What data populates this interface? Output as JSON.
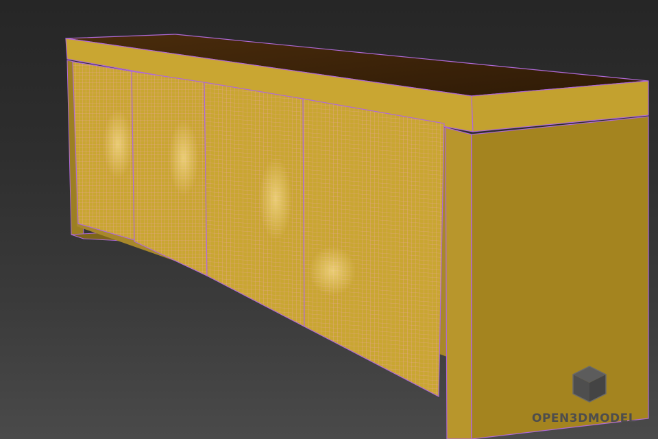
{
  "scene": {
    "subject": "sideboard-wireframe",
    "background_top": "#262626",
    "background_bottom": "#4a4a4a",
    "body_color": "#c9a632",
    "top_color": "#3a2208",
    "edge_color": "#b06ad8",
    "mesh_color": "#f2a7b6",
    "door_count": 4
  },
  "watermark": {
    "text": "OPEN3DMODEL",
    "logo": "cube-icon"
  }
}
